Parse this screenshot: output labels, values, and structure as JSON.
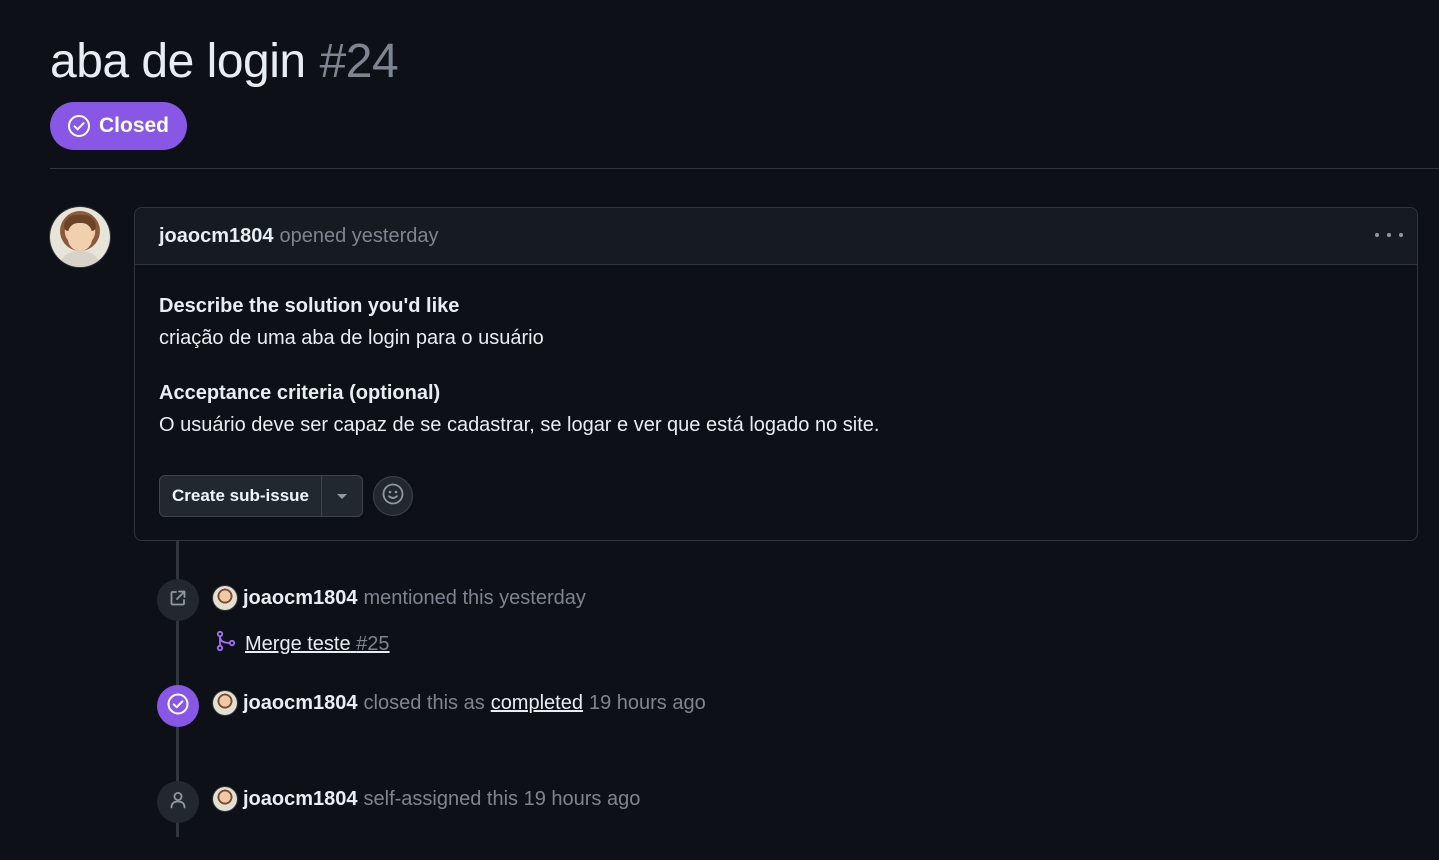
{
  "issue": {
    "title": "aba de login",
    "number": "#24",
    "state": "Closed",
    "state_color": "#8957e5"
  },
  "comment": {
    "author": "joaocm1804",
    "meta": "opened yesterday",
    "section1_heading": "Describe the solution you'd like",
    "section1_text": "criação de uma aba de login para o usuário",
    "section2_heading": "Acceptance criteria (optional)",
    "section2_text": "O usuário deve ser capaz de se cadastrar, se logar e ver que está logado no site.",
    "create_sub_issue_label": "Create sub-issue"
  },
  "timeline": {
    "mention": {
      "author": "joaocm1804",
      "text": "mentioned this yesterday",
      "ref_title": "Merge teste",
      "ref_number": "#25"
    },
    "closed": {
      "author": "joaocm1804",
      "text_before": "closed this as",
      "link": "completed",
      "text_after": "19 hours ago"
    },
    "assigned": {
      "author": "joaocm1804",
      "text": "self-assigned this 19 hours ago"
    }
  },
  "icons": {
    "state": "check-circle-icon",
    "kebab": "kebab-horizontal-icon",
    "emoji": "smiley-icon",
    "cross_ref": "link-external-icon",
    "pull_request": "git-merge-icon",
    "closed": "check-circle-icon",
    "person": "person-icon"
  }
}
